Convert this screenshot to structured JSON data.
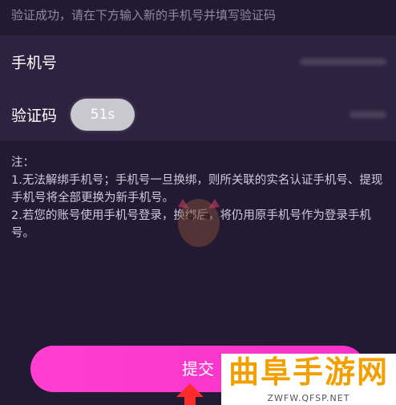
{
  "hint": "验证成功，请在下方输入新的手机号并填写验证码",
  "form": {
    "phone_label": "手机号",
    "code_label": "验证码",
    "countdown": "51s"
  },
  "notes": [
    "注：",
    "1.无法解绑手机号；手机号一旦换绑，则所关联的实名认证手机号、提现手机号将全部更换为新手机号。",
    "2.若您的账号使用手机号登录，换绑后，将仍用原手机号作为登录手机号。"
  ],
  "submit_label": "提交",
  "watermark": {
    "title": "曲阜手游网",
    "url": "ZWFW.QFSP.NET"
  },
  "colors": {
    "background": "#221a33",
    "card": "#2d2240",
    "accent": "#ff3fd0",
    "watermark": "#f2a000"
  }
}
